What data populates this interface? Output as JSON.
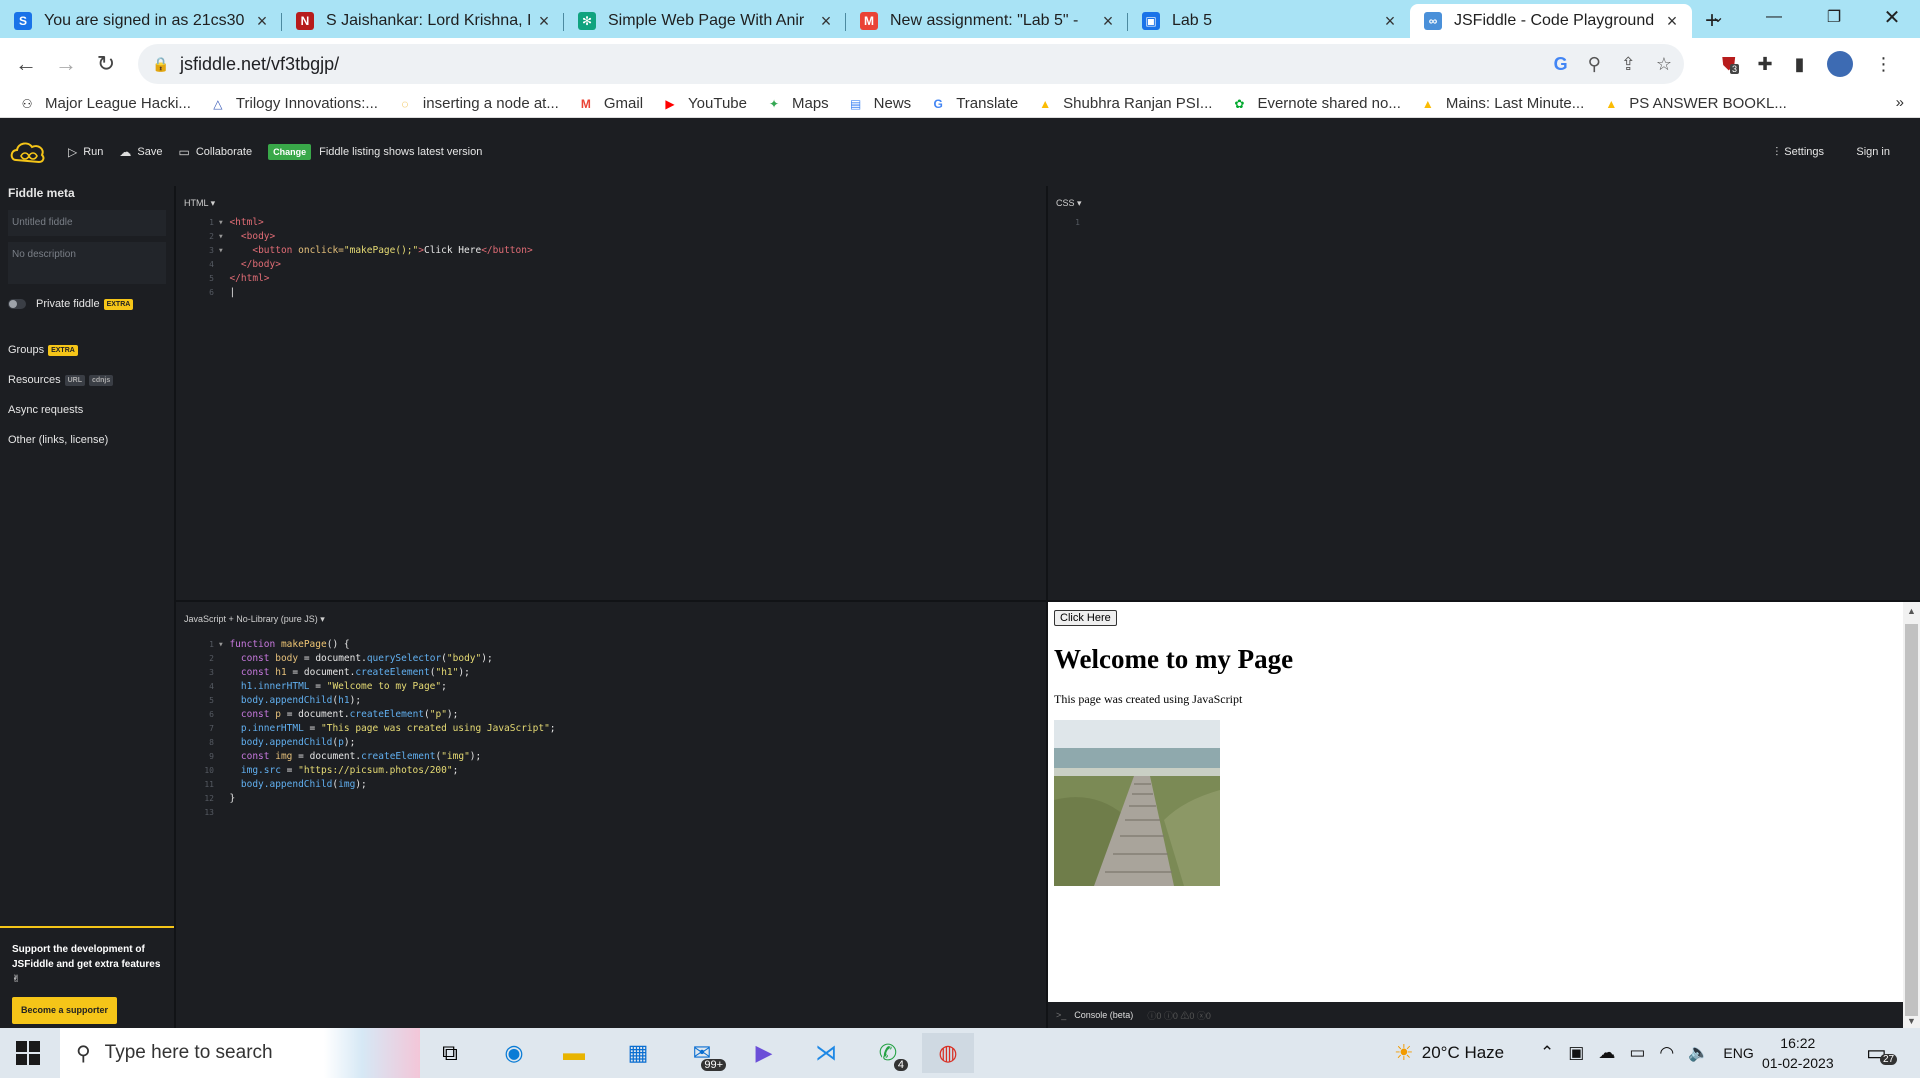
{
  "browser": {
    "tabs": [
      {
        "title": "You are signed in as 21cs30",
        "favicon": "S",
        "color": "#1a73e8"
      },
      {
        "title": "S Jaishankar: Lord Krishna, I",
        "favicon": "N",
        "color": "#b71c1c"
      },
      {
        "title": "Simple Web Page With Anir",
        "favicon": "✻",
        "color": "#10a37f"
      },
      {
        "title": "New assignment: \"Lab 5\" -",
        "favicon": "M",
        "color": "#ea4335"
      },
      {
        "title": "Lab 5",
        "favicon": "▣",
        "color": "#1a73e8"
      },
      {
        "title": "JSFiddle - Code Playground",
        "favicon": "∞",
        "color": "#4a90d9"
      }
    ],
    "url": "jsfiddle.net/vf3tbgjp/",
    "extension_badge": "3",
    "bookmarks": [
      {
        "label": "Major League Hacki...",
        "icon": "mlh-icon"
      },
      {
        "label": "Trilogy Innovations:...",
        "icon": "trilogy-icon"
      },
      {
        "label": "inserting a node at...",
        "icon": "chrome-ring-icon"
      },
      {
        "label": "Gmail",
        "icon": "gmail-icon"
      },
      {
        "label": "YouTube",
        "icon": "youtube-icon"
      },
      {
        "label": "Maps",
        "icon": "maps-icon"
      },
      {
        "label": "News",
        "icon": "news-icon"
      },
      {
        "label": "Translate",
        "icon": "translate-icon"
      },
      {
        "label": "Shubhra Ranjan PSI...",
        "icon": "drive-icon"
      },
      {
        "label": "Evernote shared no...",
        "icon": "evernote-icon"
      },
      {
        "label": "Mains: Last Minute...",
        "icon": "drive-icon"
      },
      {
        "label": "PS ANSWER BOOKL...",
        "icon": "drive-icon"
      }
    ]
  },
  "jsfiddle": {
    "toolbar": {
      "run": "Run",
      "save": "Save",
      "collaborate": "Collaborate",
      "change_badge": "Change",
      "notice": "Fiddle listing shows latest version",
      "settings": "Settings",
      "sign_in": "Sign in"
    },
    "sidebar": {
      "title": "Fiddle meta",
      "name_placeholder": "Untitled fiddle",
      "desc_placeholder": "No description",
      "private_label": "Private fiddle",
      "extra_tag": "EXTRA",
      "groups": "Groups",
      "resources": "Resources",
      "url_tag": "URL",
      "cdnjs_tag": "cdnjs",
      "async": "Async requests",
      "other": "Other (links, license)",
      "support_text": "Support the development of JSFiddle and get extra features ✌",
      "support_button": "Become a supporter"
    },
    "panels": {
      "html_label": "HTML ▾",
      "css_label": "CSS ▾",
      "js_label": "JavaScript + No-Library (pure JS) ▾"
    },
    "result": {
      "button": "Click Here",
      "heading": "Welcome to my Page",
      "paragraph": "This page was created using JavaScript"
    },
    "console": {
      "label": "Console (beta)",
      "counts": "ⓘ0  ⓘ0  ⚠0  ⓧ0"
    }
  },
  "taskbar": {
    "search_placeholder": "Type here to search",
    "mail_badge": "99+",
    "whatsapp_badge": "4",
    "weather": "20°C  Haze",
    "lang": "ENG",
    "time": "16:22",
    "date": "01-02-2023",
    "notif_badge": "27"
  }
}
